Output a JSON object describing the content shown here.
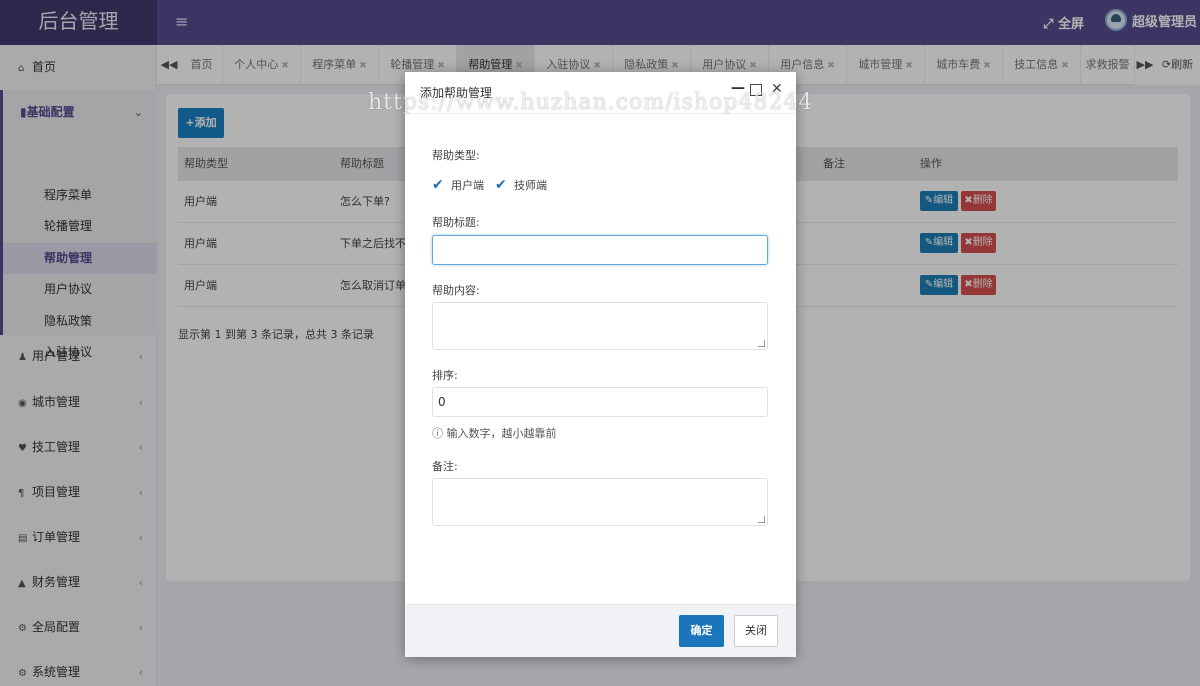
{
  "header": {
    "brand": "后台管理",
    "menu_icon": "hamburger-icon",
    "fullscreen_label": "全屏",
    "user_name": "超级管理员"
  },
  "sidebar": {
    "home": "首页",
    "group": {
      "title": "基础配置",
      "items": [
        "程序菜单",
        "轮播管理",
        "帮助管理",
        "用户协议",
        "隐私政策",
        "入驻协议"
      ],
      "active": "帮助管理"
    },
    "items": [
      {
        "label": "用户管理",
        "icon": "user-icon"
      },
      {
        "label": "城市管理",
        "icon": "globe-icon"
      },
      {
        "label": "技工管理",
        "icon": "heart-icon"
      },
      {
        "label": "项目管理",
        "icon": "paragraph-icon"
      },
      {
        "label": "订单管理",
        "icon": "bar-chart-icon"
      },
      {
        "label": "财务管理",
        "icon": "area-chart-icon"
      },
      {
        "label": "全局配置",
        "icon": "gears-icon"
      },
      {
        "label": "系统管理",
        "icon": "gear-icon"
      }
    ]
  },
  "tabs": {
    "items": [
      "首页",
      "个人中心",
      "程序菜单",
      "轮播管理",
      "帮助管理",
      "入驻协议",
      "隐私政策",
      "用户协议",
      "用户信息",
      "城市管理",
      "城市车费",
      "技工信息",
      "求救报警"
    ],
    "active": "帮助管理",
    "refresh_label": "刷新"
  },
  "toolbar": {
    "add_label": "添加"
  },
  "table": {
    "columns": [
      "帮助类型",
      "帮助标题",
      "备注",
      "操作"
    ],
    "rows": [
      {
        "type": "用户端",
        "title": "怎么下单?"
      },
      {
        "type": "用户端",
        "title": "下单之后找不到"
      },
      {
        "type": "用户端",
        "title": "怎么取消订单?"
      }
    ],
    "edit_label": "编辑",
    "delete_label": "删除",
    "summary": "显示第 1 到第 3 条记录，总共 3 条记录"
  },
  "modal": {
    "title": "添加帮助管理",
    "watermark": "https://www.huzhan.com/ishop48244",
    "type_label": "帮助类型:",
    "type_options": [
      {
        "label": "用户端",
        "checked": true
      },
      {
        "label": "技师端",
        "checked": true
      }
    ],
    "title_label": "帮助标题:",
    "title_value": "",
    "content_label": "帮助内容:",
    "content_value": "",
    "sort_label": "排序:",
    "sort_value": "0",
    "sort_hint": "输入数字，越小越靠前",
    "remark_label": "备注:",
    "remark_value": "",
    "ok_label": "确定",
    "close_label": "关闭"
  },
  "colors": {
    "header": "#564b8f",
    "brand_bg": "#45396f",
    "primary": "#1a75bd",
    "danger": "#d6504f"
  }
}
